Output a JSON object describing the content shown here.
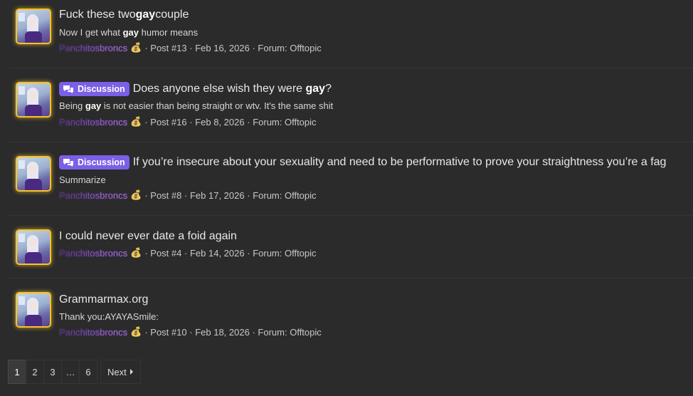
{
  "results": [
    {
      "title_parts": [
        {
          "t": "Fuck these two "
        },
        {
          "t": "gay",
          "b": true
        },
        {
          "t": " couple"
        }
      ],
      "badge": "",
      "snippet_parts": [
        {
          "t": "Now I get what "
        },
        {
          "t": "gay",
          "b": true
        },
        {
          "t": " humor means"
        }
      ],
      "username": "Panchitosbroncs",
      "post": "Post #13",
      "date": "Feb 16, 2026",
      "forum": "Forum: Offtopic"
    },
    {
      "title_parts": [
        {
          "t": "Does anyone else wish they were "
        },
        {
          "t": "gay",
          "b": true
        },
        {
          "t": "?"
        }
      ],
      "badge": "Discussion",
      "snippet_parts": [
        {
          "t": "Being "
        },
        {
          "t": "gay",
          "b": true
        },
        {
          "t": " is not easier than being straight or wtv. It's the same shit"
        }
      ],
      "username": "Panchitosbroncs",
      "post": "Post #16",
      "date": "Feb 8, 2026",
      "forum": "Forum: Offtopic"
    },
    {
      "title_parts": [
        {
          "t": "If you’re insecure about your sexuality and need to be performative to prove your straightness you’re a fag"
        }
      ],
      "badge": "Discussion",
      "snippet_parts": [
        {
          "t": "Summarize"
        }
      ],
      "username": "Panchitosbroncs",
      "post": "Post #8",
      "date": "Feb 17, 2026",
      "forum": "Forum: Offtopic"
    },
    {
      "title_parts": [
        {
          "t": "I could never ever date a foid again"
        }
      ],
      "badge": "",
      "snippet_parts": [],
      "username": "Panchitosbroncs",
      "post": "Post #4",
      "date": "Feb 14, 2026",
      "forum": "Forum: Offtopic"
    },
    {
      "title_parts": [
        {
          "t": "Grammarmax.org"
        }
      ],
      "badge": "",
      "snippet_parts": [
        {
          "t": "Thank you:AYAYASmile:"
        }
      ],
      "username": "Panchitosbroncs",
      "post": "Post #10",
      "date": "Feb 18, 2026",
      "forum": "Forum: Offtopic"
    }
  ],
  "meta_separator": "·",
  "user_emoji": "money-bag-icon",
  "pagination": {
    "pages": [
      "1",
      "2",
      "3",
      "…",
      "6"
    ],
    "active": "1",
    "next_label": "Next"
  },
  "colors": {
    "background": "#2b2b2b",
    "badge": "#7b5fe6",
    "avatar_border": "#f7c325"
  }
}
